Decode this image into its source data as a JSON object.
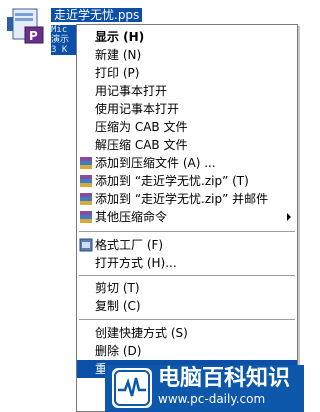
{
  "file": {
    "name": "走近学无忧.pps",
    "description_lines": [
      "Mic",
      "演示",
      "3 K"
    ]
  },
  "menu": {
    "items": [
      {
        "label": "显示 (H)",
        "bold": true
      },
      {
        "label": "新建 (N)"
      },
      {
        "label": "打印 (P)"
      },
      {
        "label": "用记事本打开"
      },
      {
        "label": "使用记事本打开"
      },
      {
        "label": "压缩为 CAB 文件"
      },
      {
        "label": "解压缩 CAB 文件"
      },
      {
        "label": "添加到压缩文件 (A) ...",
        "icon": "winrar-icon"
      },
      {
        "label": "添加到 “走近学无忧.zip” (T)",
        "icon": "winrar-icon"
      },
      {
        "label": "添加到 “走近学无忧.zip” 并邮件",
        "icon": "winrar-icon"
      },
      {
        "label": "其他压缩命令",
        "icon": "winrar-icon",
        "submenu": true
      },
      {
        "label": "格式工厂 (F)",
        "icon": "format-factory-icon"
      },
      {
        "label": "打开方式 (H)..."
      },
      {
        "label": "剪切 (T)"
      },
      {
        "label": "复制 (C)"
      },
      {
        "label": "创建快捷方式 (S)"
      },
      {
        "label": "删除 (D)"
      },
      {
        "label": "重"
      }
    ]
  },
  "watermark": {
    "title": "电脑百科知识",
    "url": "www.pc-daily.com"
  },
  "colors": {
    "highlight": "#0b4fa8",
    "watermark_bg": "#0d58aa"
  }
}
